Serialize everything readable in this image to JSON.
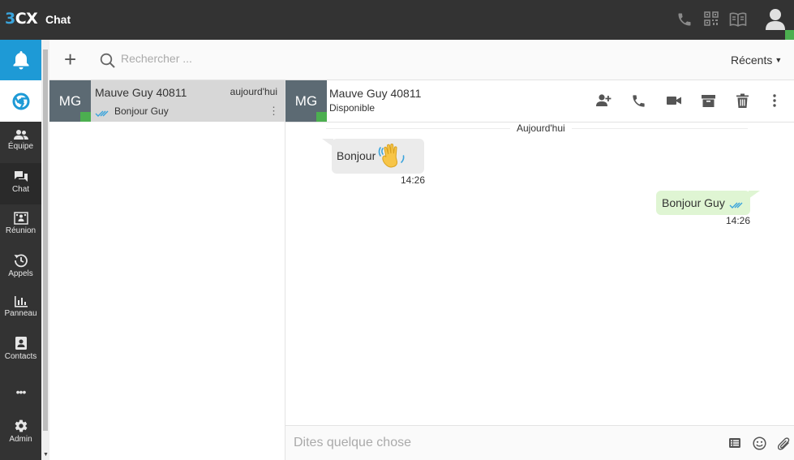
{
  "header": {
    "logo_text": "3CX",
    "logo_prefix": "3",
    "logo_suffix": "CX",
    "app_title": "Chat",
    "icons": [
      "phone-icon",
      "qr-code-icon",
      "book-icon",
      "user-avatar-icon"
    ],
    "status_color": "#4caf50"
  },
  "nav": {
    "accent_color": "#1e9ad6",
    "items": [
      {
        "id": "team",
        "label": "Équipe",
        "icon": "team-icon"
      },
      {
        "id": "chat",
        "label": "Chat",
        "icon": "chat-icon",
        "active": true
      },
      {
        "id": "meeting",
        "label": "Réunion",
        "icon": "meeting-icon"
      },
      {
        "id": "calls",
        "label": "Appels",
        "icon": "history-icon"
      },
      {
        "id": "panel",
        "label": "Panneau",
        "icon": "bar-chart-icon"
      },
      {
        "id": "contacts",
        "label": "Contacts",
        "icon": "contacts-icon"
      },
      {
        "id": "more",
        "label": "•••",
        "icon": "more-icon"
      },
      {
        "id": "admin",
        "label": "Admin",
        "icon": "gear-icon"
      }
    ]
  },
  "toolbar": {
    "add_label": "+",
    "search_placeholder": "Rechercher ...",
    "sort_label": "Récents"
  },
  "conversations": [
    {
      "initials": "MG",
      "name": "Mauve Guy 40811",
      "time": "aujourd'hui",
      "preview": "Bonjour Guy",
      "selected": true
    }
  ],
  "chat": {
    "initials": "MG",
    "name": "Mauve Guy 40811",
    "status": "Disponible",
    "actions": [
      "add-participant-icon",
      "phone-icon",
      "video-icon",
      "archive-icon",
      "trash-icon",
      "more-vertical-icon"
    ],
    "day_separator": "Aujourd'hui",
    "messages": [
      {
        "direction": "in",
        "text": "Bonjour",
        "emoji": "waving-hand",
        "time": "14:26"
      },
      {
        "direction": "out",
        "text": "Bonjour Guy",
        "time": "14:26",
        "read": true
      }
    ]
  },
  "compose": {
    "placeholder": "Dites quelque chose",
    "icons": [
      "template-icon",
      "emoji-icon",
      "attachment-icon"
    ]
  }
}
